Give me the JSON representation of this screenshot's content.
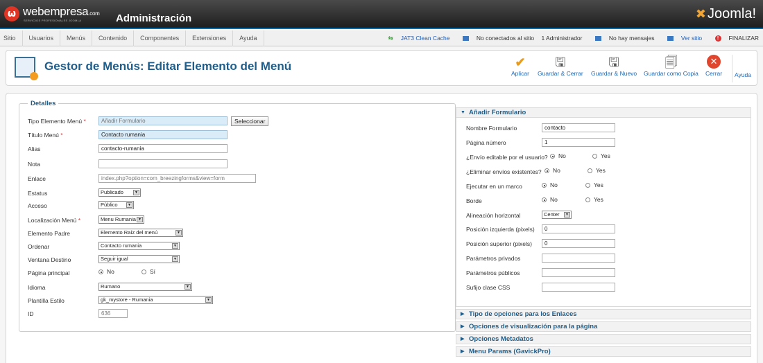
{
  "header": {
    "brand": "webempresa",
    "brand_suffix": ".com",
    "brand_tagline": "SERVICIOS PROFESIONALES JOOMLA",
    "admin_title": "Administración",
    "joomla_logo": "Joomla!"
  },
  "menubar": {
    "items": [
      "Sitio",
      "Usuarios",
      "Menús",
      "Contenido",
      "Componentes",
      "Extensiones",
      "Ayuda"
    ],
    "status": {
      "jat3": "JAT3 Clean Cache",
      "not_connected": "No conectados al sitio",
      "admins": "1 Administrador",
      "messages": "No hay mensajes",
      "view_site": "Ver sitio",
      "logout": "FINALIZAR"
    }
  },
  "toolbar": {
    "title": "Gestor de Menús: Editar Elemento del Menú",
    "apply": "Aplicar",
    "save_close": "Guardar & Cerrar",
    "save_new": "Guardar & Nuevo",
    "save_copy": "Guardar como Copia",
    "close": "Cerrar",
    "help": "Ayuda"
  },
  "details": {
    "legend": "Detalles",
    "tipo_label": "Tipo Elemento Menú",
    "tipo_value": "Añadir Formulario",
    "select_button": "Seleccionar",
    "titulo_label": "Título Menú",
    "titulo_value": "Contacto rumania",
    "alias_label": "Alias",
    "alias_value": "contacto-rumania",
    "nota_label": "Nota",
    "nota_value": "",
    "enlace_label": "Enlace",
    "enlace_value": "index.php?option=com_breezingforms&view=form",
    "estatus_label": "Estatus",
    "estatus_value": "Publicado",
    "acceso_label": "Acceso",
    "acceso_value": "Público",
    "localizacion_label": "Localización Menú",
    "localizacion_value": "Menu Rumania",
    "padre_label": "Elemento Padre",
    "padre_value": "Elemento Raíz del menú",
    "ordenar_label": "Ordenar",
    "ordenar_value": "Contacto rumania",
    "ventana_label": "Ventana Destino",
    "ventana_value": "Seguir igual",
    "principal_label": "Página principal",
    "principal_no": "No",
    "principal_si": "Sí",
    "idioma_label": "Idioma",
    "idioma_value": "Rumano",
    "plantilla_label": "Plantilla Estilo",
    "plantilla_value": "gk_mystore - Rumania",
    "id_label": "ID",
    "id_value": "636"
  },
  "form_panel": {
    "title": "Añadir Formulario",
    "nombre_label": "Nombre Formulario",
    "nombre_value": "contacto",
    "pagina_label": "Página número",
    "pagina_value": "1",
    "editable_label": "¿Envío editable por el usuario?",
    "eliminar_label": "¿Eliminar envíos existentes?",
    "marco_label": "Ejecutar en un marco",
    "borde_label": "Borde",
    "no": "No",
    "yes": "Yes",
    "alineacion_label": "Alineación horizontal",
    "alineacion_value": "Center",
    "pos_izq_label": "Posición izquierda (pixels)",
    "pos_izq_value": "0",
    "pos_sup_label": "Posición superior (pixels)",
    "pos_sup_value": "0",
    "privados_label": "Parámetros privados",
    "publicos_label": "Parámetros públicos",
    "sufijo_label": "Sufijo clase CSS"
  },
  "collapsed_panels": [
    "Tipo de opciones para los Enlaces",
    "Opciones de visualización para la página",
    "Opciones Metadatos",
    "Menu Params (GavickPro)"
  ]
}
